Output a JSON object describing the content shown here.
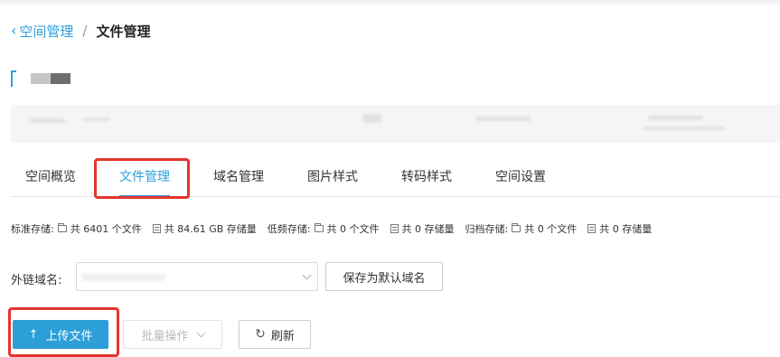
{
  "breadcrumb": {
    "parent": "空间管理",
    "separator": "/",
    "current": "文件管理"
  },
  "tabs": [
    {
      "label": "空间概览"
    },
    {
      "label": "文件管理"
    },
    {
      "label": "域名管理"
    },
    {
      "label": "图片样式"
    },
    {
      "label": "转码样式"
    },
    {
      "label": "空间设置"
    }
  ],
  "stats": {
    "standard": {
      "label": "标准存储:",
      "files": "共 6401 个文件",
      "size": "共 84.61 GB 存储量"
    },
    "low": {
      "label": "低频存储:",
      "files": "共 0 个文件",
      "size": "共 0 存储量"
    },
    "archive": {
      "label": "归档存储:",
      "files": "共 0 个文件",
      "size": "共 0 存储量"
    }
  },
  "domain": {
    "label": "外链域名:",
    "set_default_label": "保存为默认域名"
  },
  "actions": {
    "upload_label": "上传文件",
    "batch_label": "批量操作",
    "refresh_label": "刷新"
  },
  "colors": {
    "accent": "#2d9fd8",
    "highlight": "#e5342c"
  }
}
